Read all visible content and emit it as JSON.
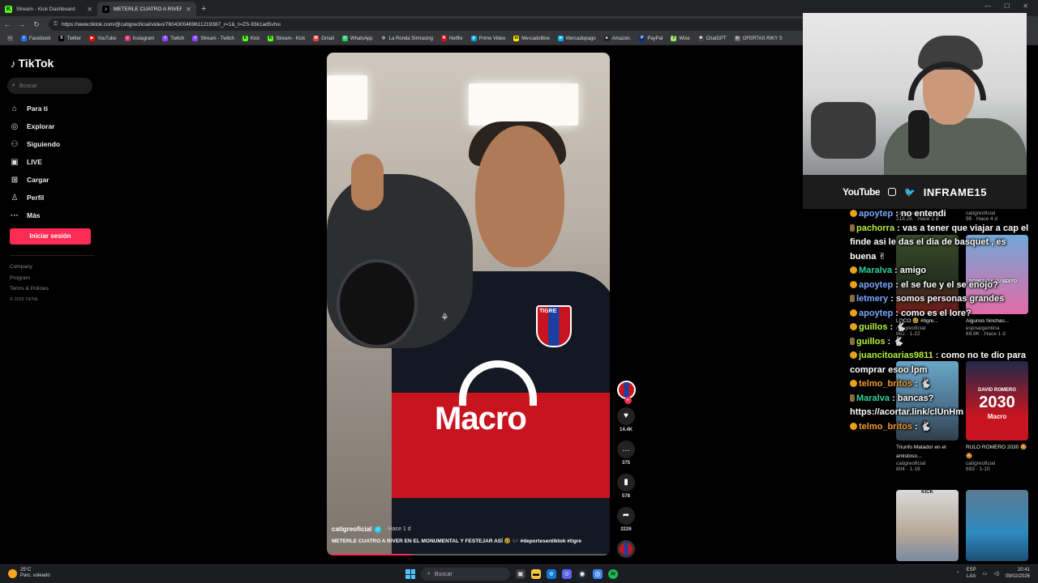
{
  "browser": {
    "tabs": [
      {
        "label": "Stream - Kick Dashboard",
        "icon": "kick-icon",
        "active": false
      },
      {
        "label": "METERLE CUATRO A RIVER EN EL",
        "icon": "tiktok-icon",
        "active": true
      }
    ],
    "url": "https://www.tiktok.com/@catigreoficial/video/7604300469611219387_r=1&_t=ZS-93k1ad5vhsi",
    "bookmarks": [
      "Facebook",
      "Twitter",
      "YouTube",
      "Instagram",
      "Twitch",
      "Stream - Twitch",
      "Kick",
      "Stream - Kick",
      "Gmail",
      "WhatsApp",
      "La Ronda Simracing",
      "Netflix",
      "Prime Video",
      "Mercadolibre",
      "Mercadopago",
      "Amazon.",
      "PayPal",
      "Wise",
      "ChatGPT",
      "OFERTAS RIKY S"
    ]
  },
  "sidebar": {
    "logo": "TikTok",
    "search_placeholder": "Buscar",
    "nav": [
      {
        "label": "Para ti",
        "icon": "home-icon"
      },
      {
        "label": "Explorar",
        "icon": "compass-icon"
      },
      {
        "label": "Siguiendo",
        "icon": "user-follow-icon"
      },
      {
        "label": "LIVE",
        "icon": "live-icon"
      },
      {
        "label": "Cargar",
        "icon": "upload-icon"
      },
      {
        "label": "Perfil",
        "icon": "profile-icon"
      },
      {
        "label": "Más",
        "icon": "more-icon"
      }
    ],
    "login": "Iniciar sesión",
    "footer": [
      "Company",
      "Program",
      "Terms & Policies"
    ],
    "copyright": "© 2026 TikTok"
  },
  "video": {
    "author": "catigreoficial",
    "when": "· Hace 1 d",
    "description": "METERLE CUATRO A RIVER EN EL MONUMENTAL Y FESTEJAR ASÍ 🤓 🎶 #deportesentiktok #tigre",
    "jersey_sponsor": "Macro",
    "jersey_badge": "TIGRE",
    "progress": 0.3
  },
  "actions": {
    "likes": "14.4K",
    "comments": "375",
    "saves": "578",
    "shares": "2226"
  },
  "recommended": [
    {
      "title": "",
      "author": "catigreoficial",
      "stats": "218.2K · Hace 1 d"
    },
    {
      "title": "",
      "author": "catigreoficial",
      "stats": "98 · Hace 4 d"
    },
    {
      "title": "LOCO 🤓 #tigre...",
      "author": "catigreoficial",
      "stats": "862 · 1-22"
    },
    {
      "title": "Algunos hinchas...",
      "author": "espnargentina",
      "stats": "69.9K · Hace 1 d"
    },
    {
      "title": "Triunfo Matador en el amistoso...",
      "author": "catigreoficial",
      "stats": "804 · 1-16"
    },
    {
      "title": "RULO ROMERO 2030 🤩🤩",
      "author": "catigreoficial",
      "stats": "693 · 1-10"
    },
    {
      "title": "",
      "author": "",
      "stats": ""
    },
    {
      "title": "",
      "author": "",
      "stats": ""
    }
  ],
  "recommended_overlay": {
    "thumb_text_1": "ROMERO Y SU SEXTO",
    "thumb_text_2": "DAVID ROMERO",
    "thumb_text_3": "2030",
    "thumb_text_4": "Macro",
    "thumb_text_5": "KICK"
  },
  "webcam": {
    "platform": "YouTube",
    "handle": "INFRAME15"
  },
  "chat": [
    {
      "user": "apoytep",
      "text": " : no entendi",
      "color": "#7aa7ff"
    },
    {
      "user": "pachorra",
      "text": " : vas a tener que viajar a cap el finde asi le das el dia de basquet , es buena ✌",
      "color": "#b8f23a"
    },
    {
      "user": "Maralva",
      "text": " : amigo",
      "color": "#2fd39a"
    },
    {
      "user": "apoytep",
      "text": " : el se fue y el se enojo?",
      "color": "#7aa7ff"
    },
    {
      "user": "letmery",
      "text": " : somos personas grandes",
      "color": "#7aa7ff"
    },
    {
      "user": "apoytep",
      "text": " : como es el lore?",
      "color": "#7aa7ff"
    },
    {
      "user": "guillos",
      "text": " : 🐇",
      "color": "#b8f23a"
    },
    {
      "user": "guillos",
      "text": " : 🐇",
      "color": "#b8f23a"
    },
    {
      "user": "juancitoarias9811",
      "text": " : como no te dio para comprar esoo lpm",
      "color": "#b8f23a"
    },
    {
      "user": "telmo_britos",
      "text": " : 🐇",
      "color": "#f29c2a"
    },
    {
      "user": "Maralva",
      "text": " : bancas? https://acortar.link/clUnHm",
      "color": "#2fd39a"
    },
    {
      "user": "telmo_britos",
      "text": " : 🐇",
      "color": "#f29c2a"
    }
  ],
  "taskbar": {
    "temp": "25°C",
    "weather": "Parc. soleado",
    "search": "Buscar",
    "lang": "ESP",
    "lang2": "LAA",
    "time": "20:41",
    "date": "09/02/2026"
  },
  "colors": {
    "accent": "#fe2c55",
    "verified": "#20d5ec"
  }
}
